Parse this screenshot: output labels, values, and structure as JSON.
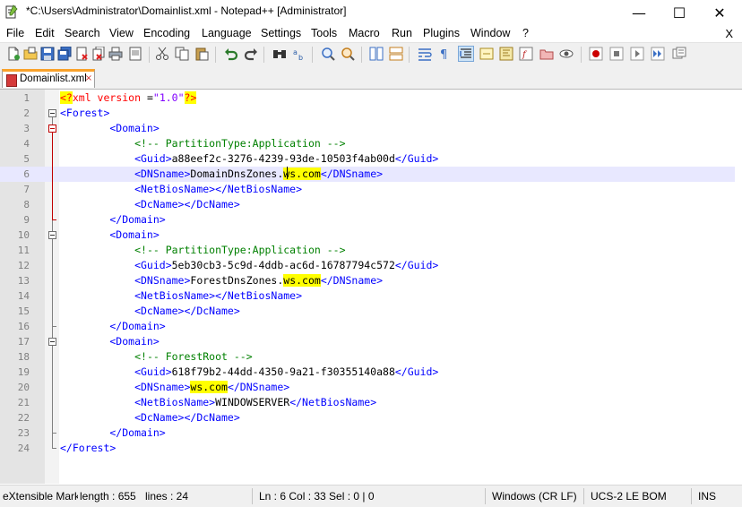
{
  "window": {
    "title": "*C:\\Users\\Administrator\\Domainlist.xml - Notepad++ [Administrator]",
    "minimize": "—",
    "maximize": "☐",
    "close": "✕"
  },
  "menu": {
    "items": [
      "File",
      "Edit",
      "Search",
      "View",
      "Encoding",
      "Language",
      "Settings",
      "Tools",
      "Macro",
      "Run",
      "Plugins",
      "Window",
      "?"
    ],
    "close_doc": "X"
  },
  "tab": {
    "label": "Domainlist.xml",
    "close": "×"
  },
  "editor": {
    "current_line": 6,
    "line_numbers": [
      "1",
      "2",
      "3",
      "4",
      "5",
      "6",
      "7",
      "8",
      "9",
      "10",
      "11",
      "12",
      "13",
      "14",
      "15",
      "16",
      "17",
      "18",
      "19",
      "20",
      "21",
      "22",
      "23",
      "24"
    ],
    "lines": [
      [
        {
          "t": "<?",
          "c": "decl"
        },
        {
          "t": "xml version ",
          "c": "attr"
        },
        {
          "t": "=",
          "c": "txt"
        },
        {
          "t": "\"1.0\"",
          "c": "val"
        },
        {
          "t": "?>",
          "c": "decl"
        }
      ],
      [
        {
          "t": "<Forest>",
          "c": "tag"
        }
      ],
      [
        {
          "t": "        <Domain>",
          "c": "tag"
        }
      ],
      [
        {
          "t": "            ",
          "c": "txt"
        },
        {
          "t": "<!-- PartitionType:Application -->",
          "c": "cmt"
        }
      ],
      [
        {
          "t": "            <Guid>",
          "c": "tag"
        },
        {
          "t": "a88eef2c-3276-4239-93de-10503f4ab00d",
          "c": "txt"
        },
        {
          "t": "</Guid>",
          "c": "tag"
        }
      ],
      [
        {
          "t": "            <DNSname>",
          "c": "tag"
        },
        {
          "t": "DomainDnsZones.",
          "c": "txt"
        },
        {
          "t": "ws.com",
          "c": "txt",
          "hl": true
        },
        {
          "t": "</DNSname>",
          "c": "tag"
        }
      ],
      [
        {
          "t": "            <NetBiosName></NetBiosName>",
          "c": "tag"
        }
      ],
      [
        {
          "t": "            <DcName></DcName>",
          "c": "tag"
        }
      ],
      [
        {
          "t": "        </Domain>",
          "c": "tag"
        }
      ],
      [
        {
          "t": "        <Domain>",
          "c": "tag"
        }
      ],
      [
        {
          "t": "            ",
          "c": "txt"
        },
        {
          "t": "<!-- PartitionType:Application -->",
          "c": "cmt"
        }
      ],
      [
        {
          "t": "            <Guid>",
          "c": "tag"
        },
        {
          "t": "5eb30cb3-5c9d-4ddb-ac6d-16787794c572",
          "c": "txt"
        },
        {
          "t": "</Guid>",
          "c": "tag"
        }
      ],
      [
        {
          "t": "            <DNSname>",
          "c": "tag"
        },
        {
          "t": "ForestDnsZones.",
          "c": "txt"
        },
        {
          "t": "ws.com",
          "c": "txt",
          "hl": true
        },
        {
          "t": "</DNSname>",
          "c": "tag"
        }
      ],
      [
        {
          "t": "            <NetBiosName></NetBiosName>",
          "c": "tag"
        }
      ],
      [
        {
          "t": "            <DcName></DcName>",
          "c": "tag"
        }
      ],
      [
        {
          "t": "        </Domain>",
          "c": "tag"
        }
      ],
      [
        {
          "t": "        <Domain>",
          "c": "tag"
        }
      ],
      [
        {
          "t": "            ",
          "c": "txt"
        },
        {
          "t": "<!-- ForestRoot -->",
          "c": "cmt"
        }
      ],
      [
        {
          "t": "            <Guid>",
          "c": "tag"
        },
        {
          "t": "618f79b2-44dd-4350-9a21-f30355140a88",
          "c": "txt"
        },
        {
          "t": "</Guid>",
          "c": "tag"
        }
      ],
      [
        {
          "t": "            <DNSname>",
          "c": "tag"
        },
        {
          "t": "ws.com",
          "c": "txt",
          "hl": true
        },
        {
          "t": "</DNSname>",
          "c": "tag"
        }
      ],
      [
        {
          "t": "            <NetBiosName>",
          "c": "tag"
        },
        {
          "t": "WINDOWSERVER",
          "c": "txt"
        },
        {
          "t": "</NetBiosName>",
          "c": "tag"
        }
      ],
      [
        {
          "t": "            <DcName></DcName>",
          "c": "tag"
        }
      ],
      [
        {
          "t": "        </Domain>",
          "c": "tag"
        }
      ],
      [
        {
          "t": "</Forest>",
          "c": "tag"
        }
      ]
    ]
  },
  "status": {
    "file_type": "eXtensible Mark",
    "length": "length : 655",
    "lines": "lines : 24",
    "position": "Ln : 6    Col : 33    Sel : 0 | 0",
    "eol": "Windows (CR LF)",
    "encoding": "UCS-2 LE BOM",
    "mode": "INS"
  },
  "colors": {
    "tag": "#0000ff",
    "comment": "#008000",
    "decl": "#ff0000",
    "highlight": "#ffff00",
    "current_line": "#e8e8ff",
    "tab_accent": "#f9a22b"
  },
  "toolbar_icons": [
    "new-file-icon",
    "open-file-icon",
    "save-icon",
    "save-all-icon",
    "close-icon",
    "close-all-icon",
    "print-icon",
    "cut-icon",
    "copy-icon",
    "paste-icon",
    "undo-icon",
    "redo-icon",
    "find-icon",
    "replace-icon",
    "zoom-in-icon",
    "zoom-out-icon",
    "sync-vertical-icon",
    "sync-horizontal-icon",
    "word-wrap-icon",
    "show-all-chars-icon",
    "indent-guide-icon",
    "language-udl-icon",
    "doc-map-icon",
    "function-list-icon",
    "folder-workspace-icon",
    "monitoring-icon",
    "record-macro-icon",
    "stop-macro-icon",
    "play-macro-icon",
    "run-macro-multiple-icon",
    "save-macro-icon"
  ]
}
